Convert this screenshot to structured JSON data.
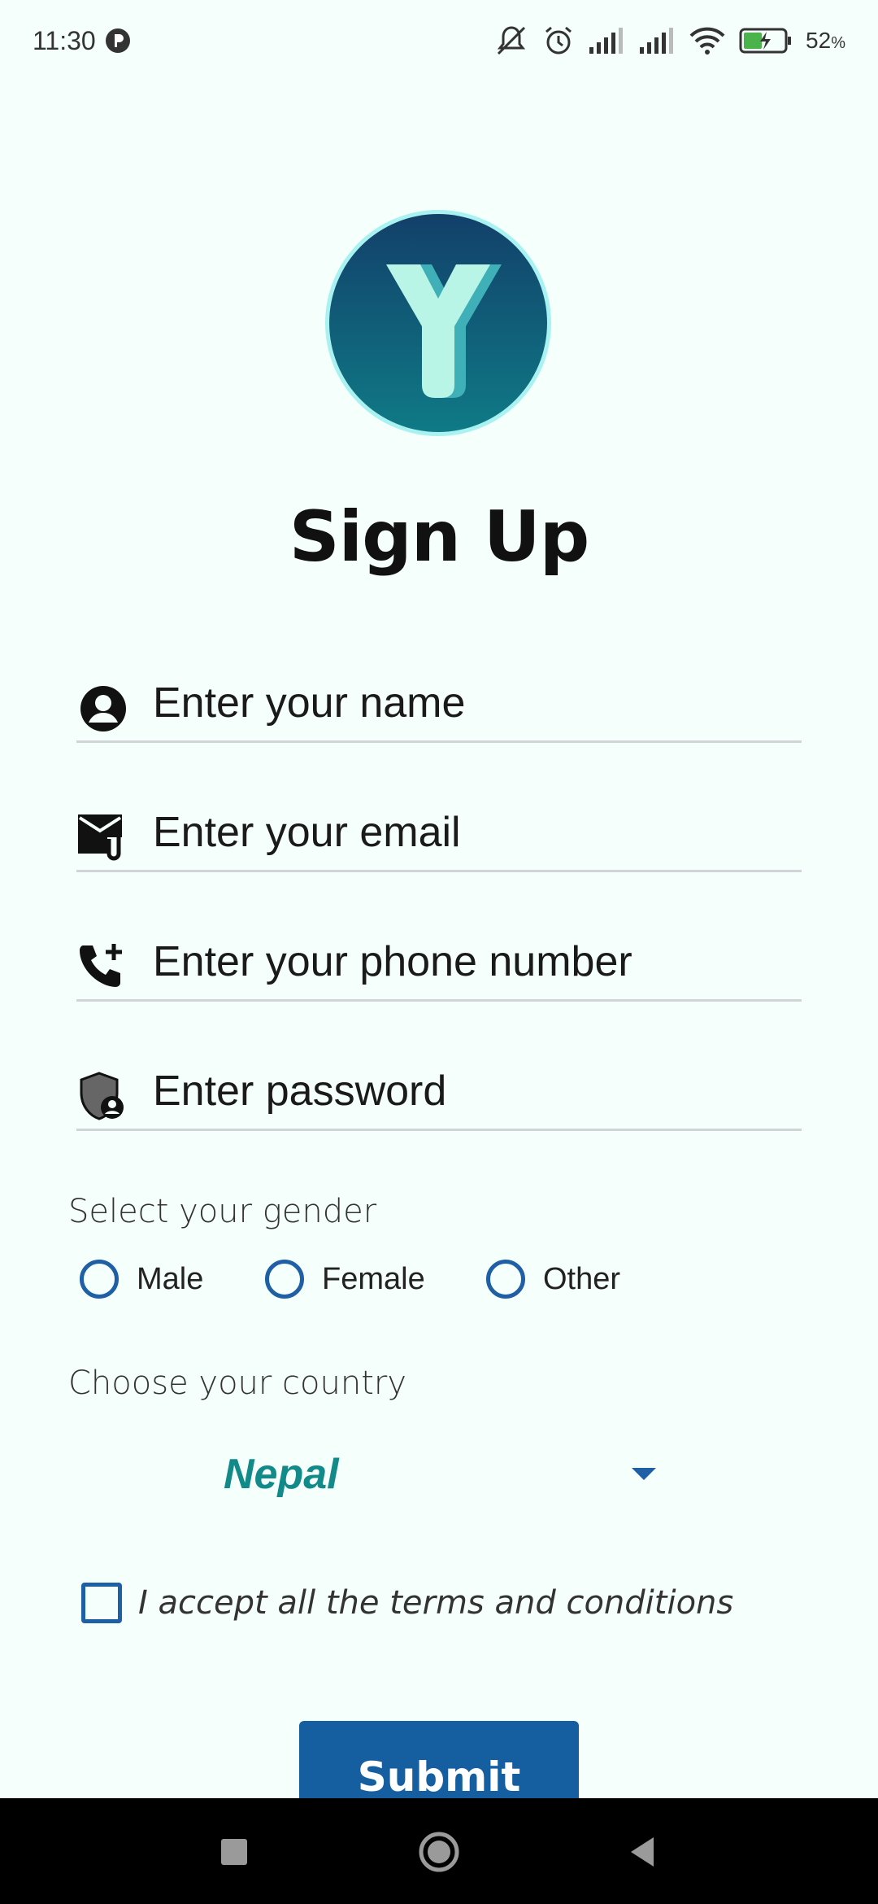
{
  "status_bar": {
    "time": "11:30",
    "battery": "52",
    "battery_unit": "%",
    "icons": [
      "notification-dot-icon",
      "mute-icon",
      "alarm-icon",
      "signal-icon",
      "signal-icon",
      "wifi-icon",
      "battery-charging-icon"
    ]
  },
  "logo": {
    "letter": "Y"
  },
  "page": {
    "title": "Sign Up"
  },
  "fields": [
    {
      "icon": "account-circle-icon",
      "placeholder": "Enter your name"
    },
    {
      "icon": "email-attachment-icon",
      "placeholder": "Enter your email"
    },
    {
      "icon": "phone-add-icon",
      "placeholder": "Enter your phone number"
    },
    {
      "icon": "shield-person-icon",
      "placeholder": "Enter password"
    }
  ],
  "gender": {
    "label": "Select your gender",
    "options": [
      "Male",
      "Female",
      "Other"
    ]
  },
  "country": {
    "label": "Choose your country",
    "selected": "Nepal"
  },
  "terms": {
    "label": "I accept all the terms and conditions"
  },
  "submit": {
    "label": "Submit"
  },
  "colors": {
    "accent": "#155fa0",
    "country_text": "#128a8a",
    "background": "#f5fffb"
  }
}
